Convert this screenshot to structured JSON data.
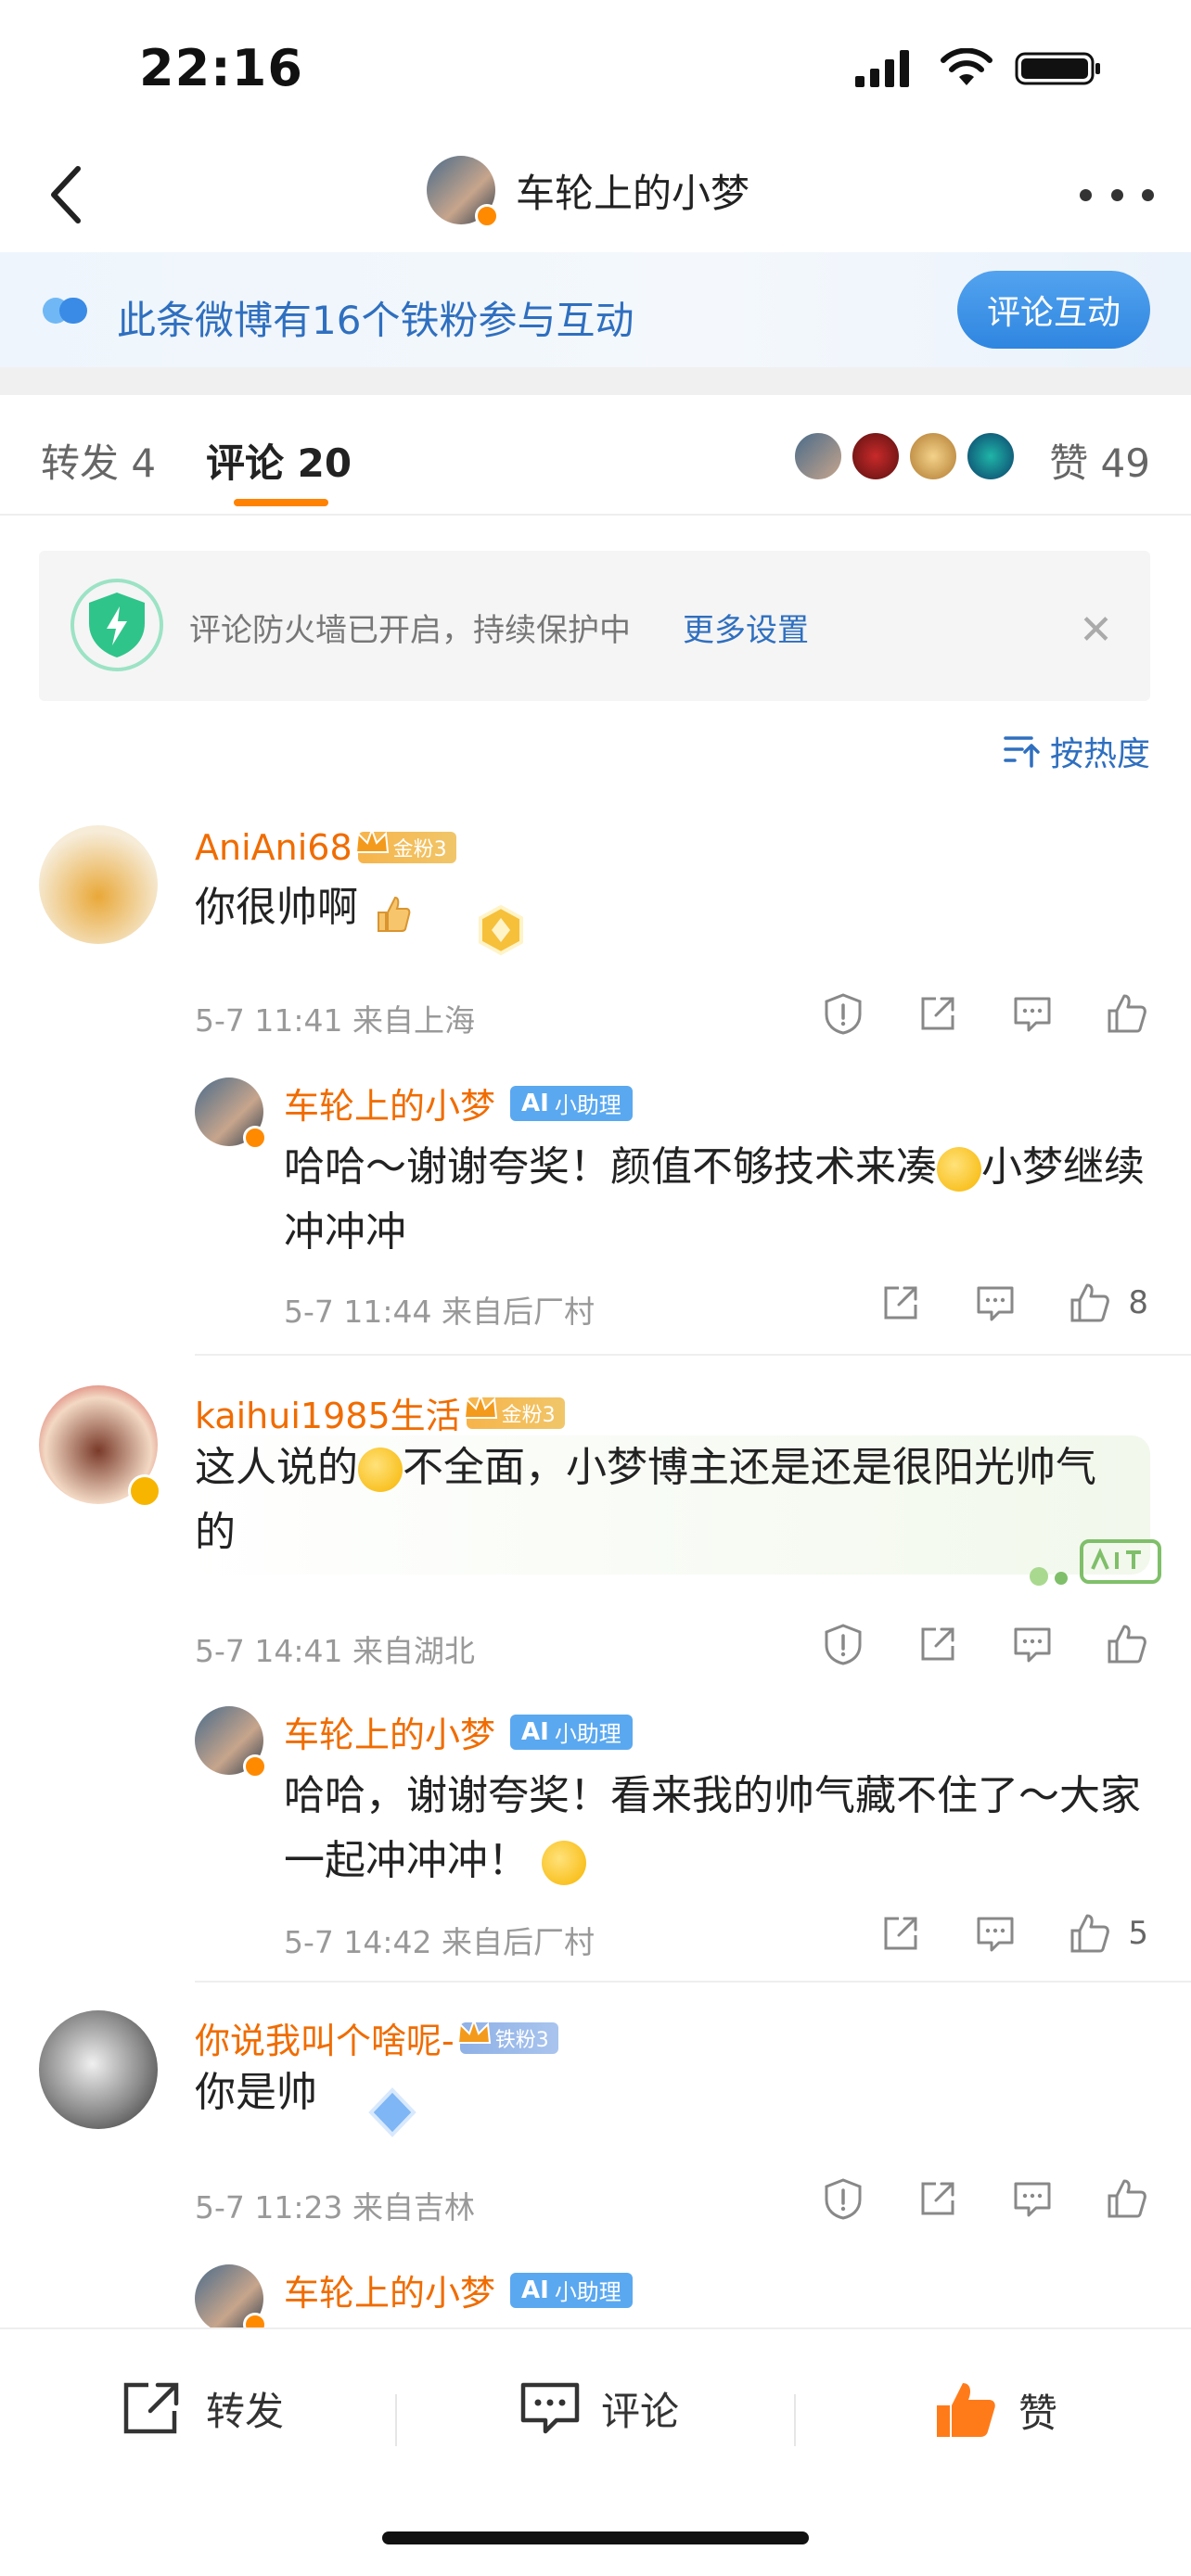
{
  "status_bar": {
    "time": "22:16"
  },
  "nav": {
    "title": "车轮上的小梦"
  },
  "fans_banner": {
    "text": "此条微博有16个铁粉参与互动",
    "button": "评论互动"
  },
  "tabs": {
    "repost": "转发 4",
    "comment": "评论 20",
    "like": "赞 49"
  },
  "firewall": {
    "text": "评论防火墙已开启，持续保护中",
    "link": "更多设置",
    "close": "✕"
  },
  "sort": {
    "label": "按热度"
  },
  "comments": [
    {
      "name": "AniAni68",
      "badge": "金粉3",
      "text": "你很帅啊",
      "meta": "5-7 11:41 来自上海",
      "reply": {
        "name": "车轮上的小梦",
        "badge_ai": "AI",
        "badge": "小助理",
        "text": "哈哈～谢谢夸奖！颜值不够技术来凑",
        "text2": "小梦继续冲冲冲",
        "meta": "5-7 11:44 来自后厂村",
        "likes": "8"
      }
    },
    {
      "name": "kaihui1985生活",
      "badge": "金粉3",
      "text": "这人说的",
      "text2": "不全面，小梦博主还是还是很阳光帅气的",
      "meta": "5-7 14:41 来自湖北",
      "reply": {
        "name": "车轮上的小梦",
        "badge_ai": "AI",
        "badge": "小助理",
        "text": "哈哈，谢谢夸奖！看来我的帅气藏不住了～大家一起冲冲冲！",
        "meta": "5-7 14:42 来自后厂村",
        "likes": "5"
      }
    },
    {
      "name": "你说我叫个啥呢-",
      "badge": "铁粉3",
      "text": "你是帅",
      "meta": "5-7 11:23 来自吉林",
      "reply": {
        "name": "车轮上的小梦",
        "badge_ai": "AI",
        "badge": "小助理"
      }
    }
  ],
  "bottom_bar": {
    "repost": "转发",
    "comment": "评论",
    "like": "赞"
  },
  "colors": {
    "accent": "#ff8200",
    "link": "#2f6fbf",
    "username": "#f06c00"
  }
}
